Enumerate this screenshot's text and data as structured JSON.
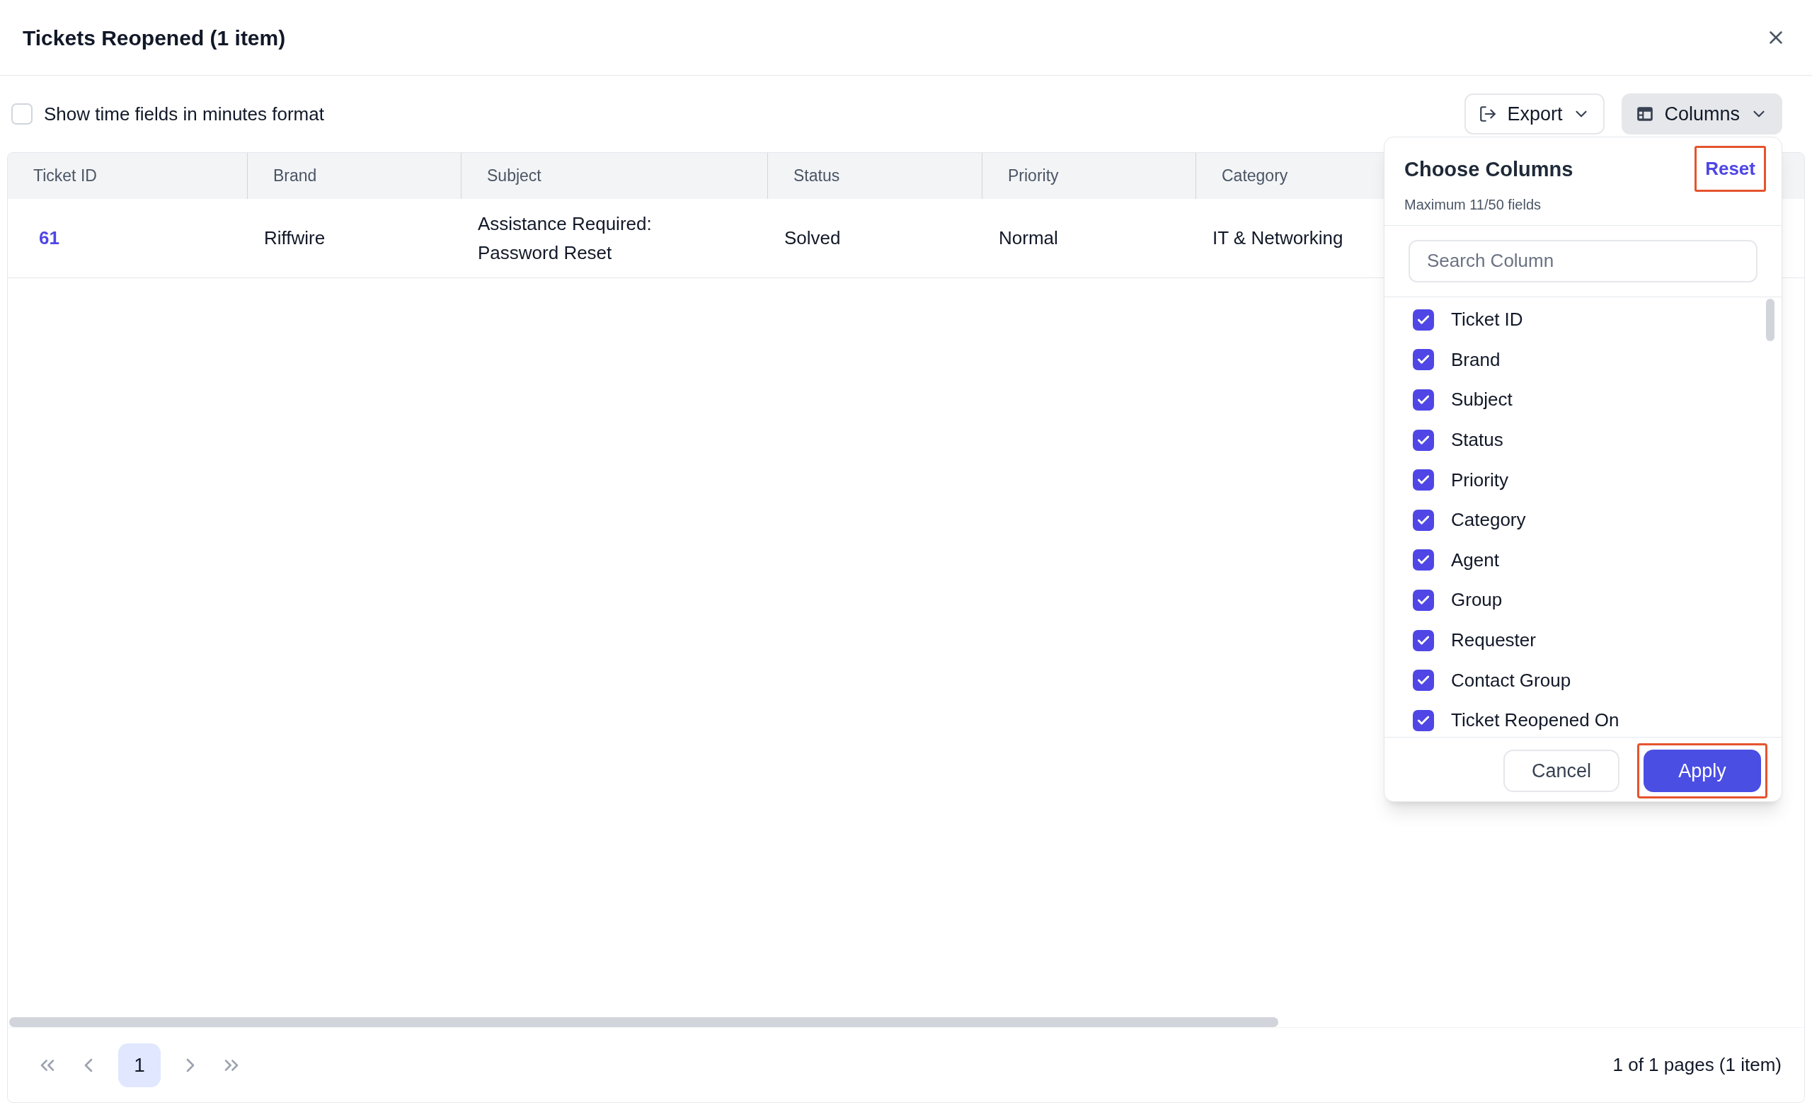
{
  "dialog": {
    "title": "Tickets Reopened (1 item)"
  },
  "toolbar": {
    "minutes_format": {
      "label": "Show time fields in minutes format",
      "checked": false
    },
    "buttons": [
      {
        "label": "Export",
        "kind": "export",
        "active": false
      },
      {
        "label": "Columns",
        "kind": "columns",
        "active": true
      }
    ]
  },
  "table": {
    "columns": [
      "Ticket ID",
      "Brand",
      "Subject",
      "Status",
      "Priority",
      "Category"
    ],
    "rows": [
      {
        "cells": [
          "61",
          "Riffwire",
          "Assistance Required: Password Reset",
          "Solved",
          "Normal",
          "IT & Networking"
        ]
      }
    ]
  },
  "column_chooser": {
    "title": "Choose Columns",
    "subtitle": "Maximum 11/50 fields",
    "reset": {
      "label": "Reset",
      "highlighted": true
    },
    "search": {
      "placeholder": "Search Column"
    },
    "items": [
      {
        "label": "Ticket ID",
        "checked": true
      },
      {
        "label": "Brand",
        "checked": true
      },
      {
        "label": "Subject",
        "checked": true
      },
      {
        "label": "Status",
        "checked": true
      },
      {
        "label": "Priority",
        "checked": true
      },
      {
        "label": "Category",
        "checked": true
      },
      {
        "label": "Agent",
        "checked": true
      },
      {
        "label": "Group",
        "checked": true
      },
      {
        "label": "Requester",
        "checked": true
      },
      {
        "label": "Contact Group",
        "checked": true
      },
      {
        "label": "Ticket Reopened On",
        "checked": true
      }
    ],
    "buttons": [
      {
        "label": "Cancel",
        "kind": "secondary",
        "highlighted": false
      },
      {
        "label": "Apply",
        "kind": "primary",
        "highlighted": true
      }
    ]
  },
  "pagination": {
    "pages": [
      {
        "label": "1",
        "selected": true
      }
    ],
    "summary": "1 of 1 pages (1 item)"
  }
}
